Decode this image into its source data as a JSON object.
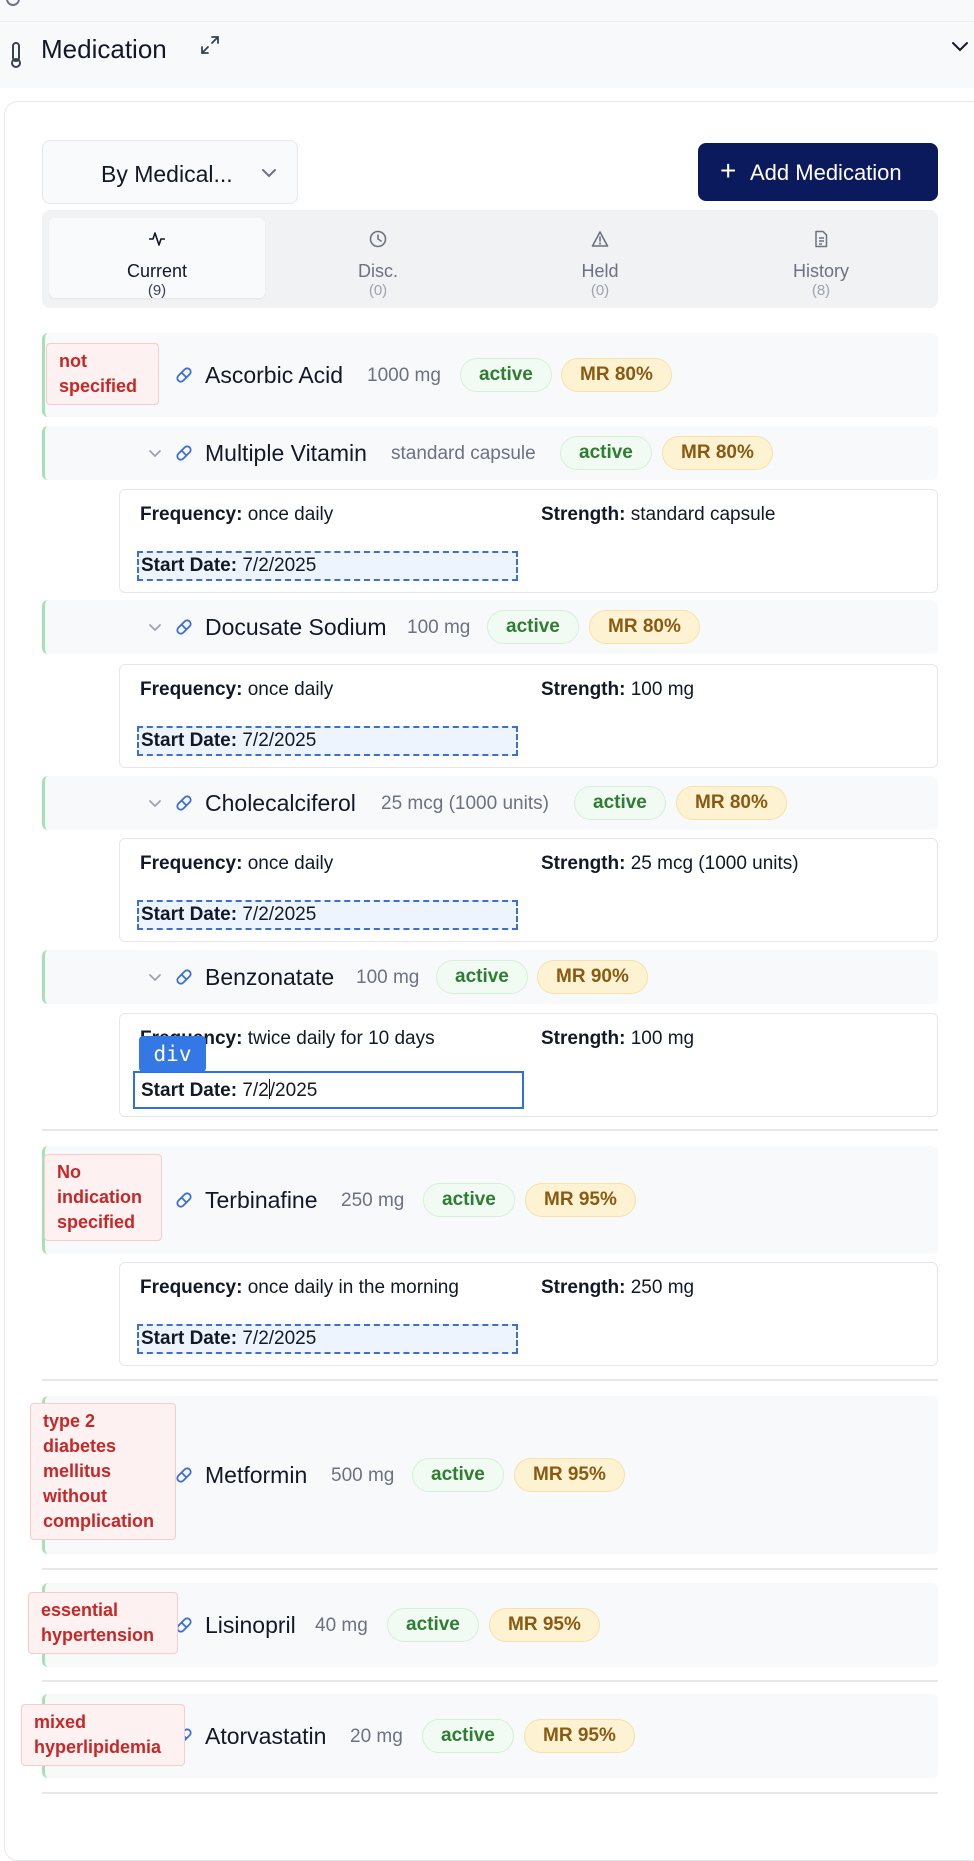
{
  "section": {
    "title": "Medication"
  },
  "toolbar": {
    "sort_label": "By Medical...",
    "add_label": "Add Medication",
    "add_icon": "+"
  },
  "tabs": [
    {
      "label": "Current",
      "count": "(9)"
    },
    {
      "label": "Disc.",
      "count": "(0)"
    },
    {
      "label": "Held",
      "count": "(0)"
    },
    {
      "label": "History",
      "count": "(8)"
    }
  ],
  "labels": {
    "frequency": "Frequency:",
    "strength": "Strength:",
    "start_date": "Start Date:"
  },
  "groups": [
    {
      "indication": "not specified"
    },
    {
      "indication": "No indication specified"
    },
    {
      "indication": "type 2 diabetes mellitus without complication"
    },
    {
      "indication": "essential hypertension"
    },
    {
      "indication": "mixed hyperlipidemia"
    }
  ],
  "medications": [
    {
      "name": "Ascorbic Acid",
      "dose": "1000 mg",
      "status": "active",
      "mr": "MR 80%"
    },
    {
      "name": "Multiple Vitamin",
      "dose": "standard capsule",
      "status": "active",
      "mr": "MR 80%",
      "frequency": "once daily",
      "strength": "standard capsule",
      "start_date": "7/2/2025"
    },
    {
      "name": "Docusate Sodium",
      "dose": "100 mg",
      "status": "active",
      "mr": "MR 80%",
      "frequency": "once daily",
      "strength": "100 mg",
      "start_date": "7/2/2025"
    },
    {
      "name": "Cholecalciferol",
      "dose": "25 mcg (1000 units)",
      "status": "active",
      "mr": "MR 80%",
      "frequency": "once daily",
      "strength": "25 mcg (1000 units)",
      "start_date": "7/2/2025"
    },
    {
      "name": "Benzonatate",
      "dose": "100 mg",
      "status": "active",
      "mr": "MR 90%",
      "frequency": "twice daily for 10 days",
      "strength": "100 mg",
      "start_date_before_caret": "7/2",
      "start_date_after_caret": "/2025"
    },
    {
      "name": "Terbinafine",
      "dose": "250 mg",
      "status": "active",
      "mr": "MR 95%",
      "frequency": "once daily in the morning",
      "strength": "250 mg",
      "start_date": "7/2/2025"
    },
    {
      "name": "Metformin",
      "dose": "500 mg",
      "status": "active",
      "mr": "MR 95%"
    },
    {
      "name": "Lisinopril",
      "dose": "40 mg",
      "status": "active",
      "mr": "MR 95%"
    },
    {
      "name": "Atorvastatin",
      "dose": "20 mg",
      "status": "active",
      "mr": "MR 95%"
    }
  ],
  "inspector": {
    "tag": "div"
  },
  "colors": {
    "primary": "#0b1a5c",
    "active_text": "#2e7d32",
    "mr_text": "#8a5a12",
    "indication_text": "#c62828",
    "focus": "#2f6fe0"
  }
}
